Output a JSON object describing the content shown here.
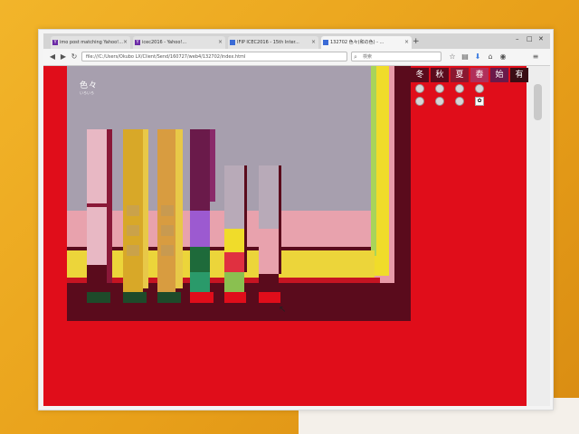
{
  "browser": {
    "tabs": [
      {
        "label": "imo post matching Yahoo!..."
      },
      {
        "label": "icec2016 - Yahoo!..."
      },
      {
        "label": "IFIP ICEC2016 - 15th Inter..."
      },
      {
        "label": "132702 色々(和の色) - ..."
      }
    ],
    "new_tab": "+",
    "url": "file:///C:/Users/Okubo LX/Client/Send/160727/web4/132702/index.html",
    "search_placeholder": "検索",
    "window_controls": {
      "min": "–",
      "max": "□",
      "close": "✕"
    }
  },
  "page": {
    "logo_title": "色々",
    "logo_subtitle": "いろいろ",
    "seasons": [
      {
        "label": "冬",
        "color": "#5a0b1c"
      },
      {
        "label": "秋",
        "color": "#5a0b1c"
      },
      {
        "label": "夏",
        "color": "#8a1830"
      },
      {
        "label": "春",
        "color": "#b0305a"
      },
      {
        "label": "始",
        "color": "#6a1a4a"
      },
      {
        "label": "有",
        "color": "#3a0d14"
      }
    ],
    "toggle_mark": "✿",
    "cursor": "↖"
  }
}
